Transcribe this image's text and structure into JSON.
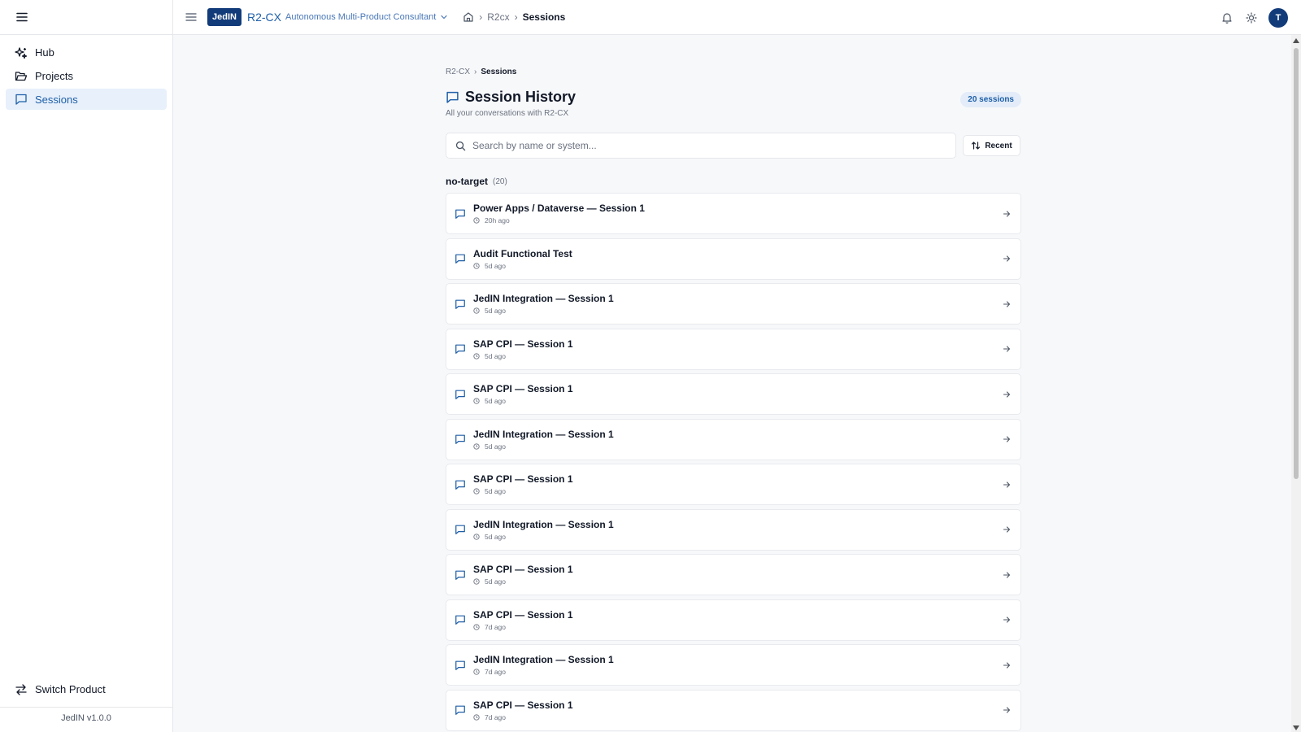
{
  "sidebar": {
    "items": [
      {
        "label": "Hub",
        "icon": "sparkles-icon"
      },
      {
        "label": "Projects",
        "icon": "folder-icon"
      },
      {
        "label": "Sessions",
        "icon": "chat-icon",
        "active": true
      }
    ],
    "switch_product": "Switch Product",
    "version": "JedIN v1.0.0"
  },
  "header": {
    "logo": "JedIN",
    "product_name": "R2-CX",
    "product_subtitle": "Autonomous Multi-Product Consultant",
    "breadcrumbs": [
      "R2cx",
      "Sessions"
    ],
    "avatar_initial": "T"
  },
  "page": {
    "breadcrumbs": [
      "R2-CX",
      "Sessions"
    ],
    "title": "Session History",
    "subtitle": "All your conversations with R2-CX",
    "count_badge": "20 sessions",
    "search_placeholder": "Search by name or system...",
    "sort_label": "Recent",
    "group": {
      "name": "no-target",
      "count": "(20)"
    },
    "sessions": [
      {
        "title": "Power Apps / Dataverse — Session 1",
        "time": "20h ago"
      },
      {
        "title": "Audit Functional Test",
        "time": "5d ago"
      },
      {
        "title": "JedIN Integration — Session 1",
        "time": "5d ago"
      },
      {
        "title": "SAP CPI — Session 1",
        "time": "5d ago"
      },
      {
        "title": "SAP CPI — Session 1",
        "time": "5d ago"
      },
      {
        "title": "JedIN Integration — Session 1",
        "time": "5d ago"
      },
      {
        "title": "SAP CPI — Session 1",
        "time": "5d ago"
      },
      {
        "title": "JedIN Integration — Session 1",
        "time": "5d ago"
      },
      {
        "title": "SAP CPI — Session 1",
        "time": "5d ago"
      },
      {
        "title": "SAP CPI — Session 1",
        "time": "7d ago"
      },
      {
        "title": "JedIN Integration — Session 1",
        "time": "7d ago"
      },
      {
        "title": "SAP CPI — Session 1",
        "time": "7d ago"
      }
    ]
  },
  "colors": {
    "accent": "#1e5fa8",
    "brand_dark": "#123b7a",
    "active_bg": "#e7f0fb"
  }
}
